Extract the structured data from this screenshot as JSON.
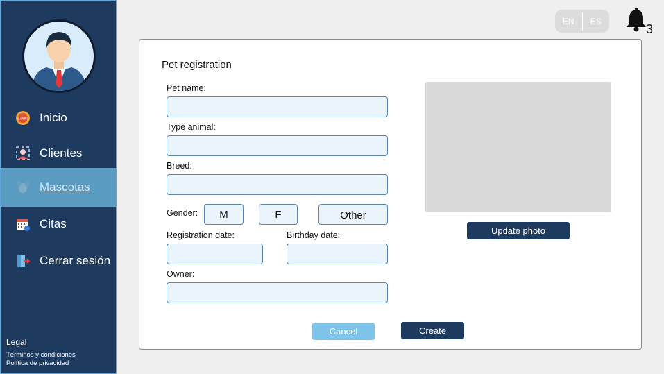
{
  "sidebar": {
    "items": [
      {
        "label": "Inicio",
        "icon": "start-badge-icon"
      },
      {
        "label": "Clientes",
        "icon": "clients-icon"
      },
      {
        "label": "Mascotas",
        "icon": "pet-icon"
      },
      {
        "label": "Citas",
        "icon": "calendar-icon"
      },
      {
        "label": "Cerrar sesión",
        "icon": "logout-icon"
      }
    ],
    "active_item": "Mascotas",
    "legal": {
      "heading": "Legal",
      "links": [
        "Términos y condiciones",
        "Política de privacidad"
      ]
    }
  },
  "header": {
    "languages": [
      "EN",
      "ES"
    ],
    "notifications_count": "3"
  },
  "form": {
    "title": "Pet registration",
    "fields": {
      "pet_name": {
        "label": "Pet name:",
        "value": ""
      },
      "type_animal": {
        "label": "Type animal:",
        "value": ""
      },
      "breed": {
        "label": "Breed:",
        "value": ""
      },
      "registration_date": {
        "label": "Registration date:",
        "value": ""
      },
      "birthday_date": {
        "label": "Birthday date:",
        "value": ""
      },
      "owner": {
        "label": "Owner:",
        "value": ""
      }
    },
    "gender": {
      "label": "Gender:",
      "options": [
        "M",
        "F",
        "Other"
      ]
    },
    "update_photo_label": "Update photo",
    "cancel_label": "Cancel",
    "create_label": "Create"
  },
  "colors": {
    "sidebar_bg": "#1f3a5f",
    "active_item_bg": "#5a9bc2",
    "input_bg": "#e9f4fc",
    "primary_button": "#1f3a5f",
    "cancel_button": "#7ec4ea"
  }
}
